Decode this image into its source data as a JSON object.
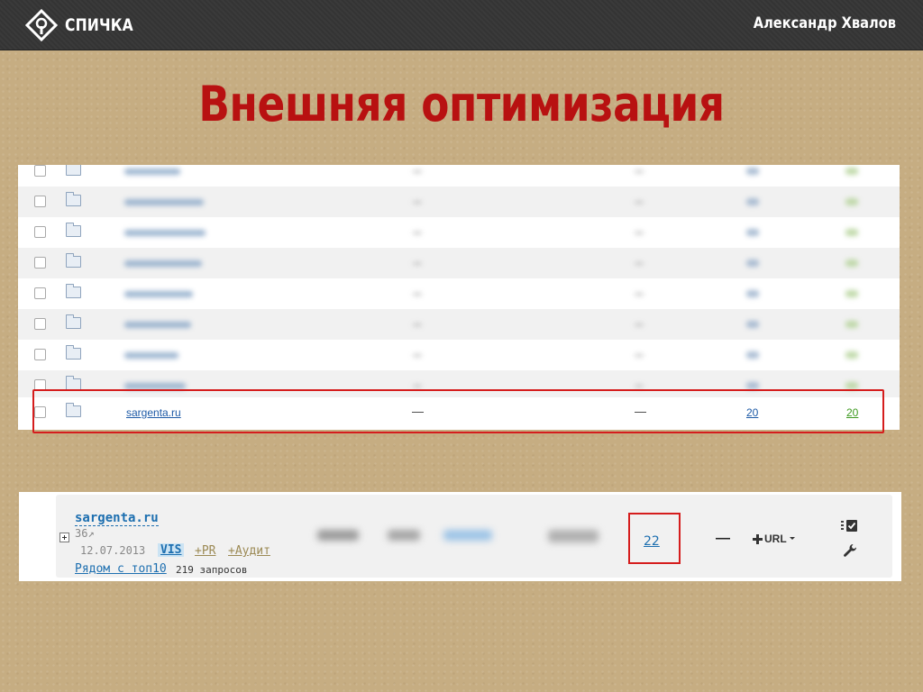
{
  "header": {
    "logo_text": "СПИЧКА",
    "author": "Александр Хвалов"
  },
  "title": "Внешняя оптимизация",
  "table": {
    "highlighted_row": {
      "site": "sargenta.ru",
      "col1": "—",
      "col2": "—",
      "value_a": "20",
      "value_b": "20"
    }
  },
  "site_panel": {
    "site": "sargenta.ru",
    "rank": "36↗",
    "date": "12.07.2013",
    "vis_label": "VIS",
    "pr_label": "+PR",
    "audit_label": "+Аудит",
    "near_top_link": "Рядом с топ10",
    "queries_text": "219 запросов",
    "highlighted_value": "22",
    "dash": "—",
    "url_button": "URL"
  },
  "colors": {
    "title_red": "#b81111",
    "highlight_red": "#d51d1d",
    "link_blue": "#1d5aa6",
    "positive_green": "#3d9a1f",
    "header_bg": "#343434"
  }
}
